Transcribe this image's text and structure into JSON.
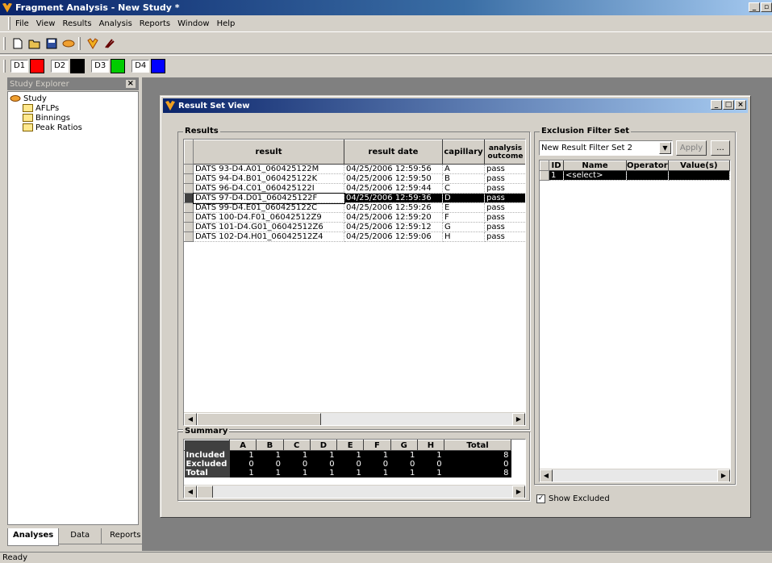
{
  "app": {
    "title": "Fragment Analysis - New Study *"
  },
  "menu": [
    "File",
    "View",
    "Results",
    "Analysis",
    "Reports",
    "Window",
    "Help"
  ],
  "dyes": [
    {
      "label": "D1",
      "color": "#ff0000"
    },
    {
      "label": "D2",
      "color": "#000000"
    },
    {
      "label": "D3",
      "color": "#00cc00"
    },
    {
      "label": "D4",
      "color": "#0000ff"
    }
  ],
  "explorer": {
    "title": "Study Explorer",
    "root": "Study",
    "children": [
      "AFLPs",
      "Binnings",
      "Peak Ratios"
    ],
    "tabs": [
      "Analyses",
      "Data",
      "Reports"
    ]
  },
  "resultset": {
    "title": "Result Set View",
    "results_label": "Results",
    "columns": [
      "result",
      "result date",
      "capillary",
      "analysis outcome"
    ],
    "rows": [
      [
        "DATS 93-D4.A01_060425122M",
        "04/25/2006 12:59:56",
        "A",
        "pass"
      ],
      [
        "DATS 94-D4.B01_060425122K",
        "04/25/2006 12:59:50",
        "B",
        "pass"
      ],
      [
        "DATS 96-D4.C01_060425122I",
        "04/25/2006 12:59:44",
        "C",
        "pass"
      ],
      [
        "DATS 97-D4.D01_060425122F",
        "04/25/2006 12:59:36",
        "D",
        "pass"
      ],
      [
        "DATS 99-D4.E01_060425122C",
        "04/25/2006 12:59:26",
        "E",
        "pass"
      ],
      [
        "DATS 100-D4.F01_06042512Z9",
        "04/25/2006 12:59:20",
        "F",
        "pass"
      ],
      [
        "DATS 101-D4.G01_06042512Z6",
        "04/25/2006 12:59:12",
        "G",
        "pass"
      ],
      [
        "DATS 102-D4.H01_06042512Z4",
        "04/25/2006 12:59:06",
        "H",
        "pass"
      ]
    ],
    "summary_label": "Summary",
    "summary_cols": [
      "A",
      "B",
      "C",
      "D",
      "E",
      "F",
      "G",
      "H",
      "Total"
    ],
    "summary_rows": [
      {
        "label": "Included",
        "values": [
          "1",
          "1",
          "1",
          "1",
          "1",
          "1",
          "1",
          "1",
          "8"
        ]
      },
      {
        "label": "Excluded",
        "values": [
          "0",
          "0",
          "0",
          "0",
          "0",
          "0",
          "0",
          "0",
          "0"
        ]
      },
      {
        "label": "Total",
        "values": [
          "1",
          "1",
          "1",
          "1",
          "1",
          "1",
          "1",
          "1",
          "8"
        ]
      }
    ],
    "filter_label": "Exclusion Filter Set",
    "filter_set": "New Result Filter Set 2",
    "apply": "Apply",
    "more": "...",
    "filter_cols": [
      "ID",
      "Name",
      "Operator",
      "Value(s)"
    ],
    "filter_rows": [
      [
        "1",
        "<select>",
        "",
        ""
      ]
    ],
    "show_excluded": "Show Excluded"
  },
  "status": "Ready"
}
